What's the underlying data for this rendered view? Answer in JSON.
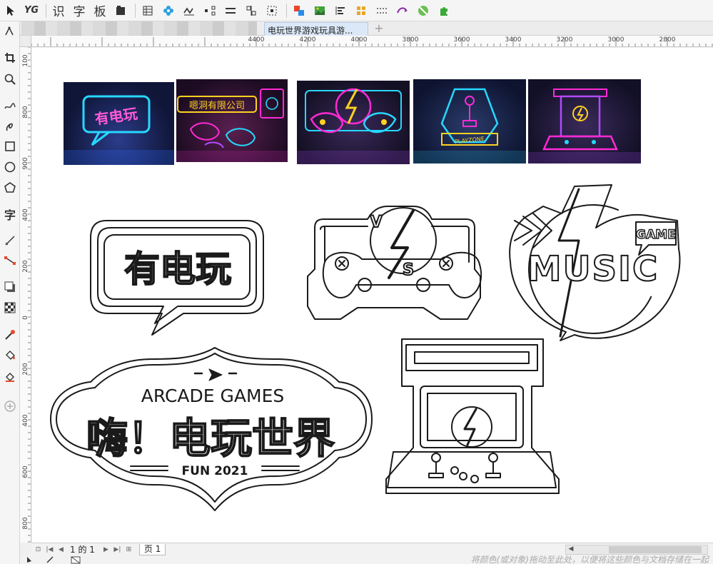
{
  "toolbar": {
    "text_tools": [
      "识",
      "字",
      "板"
    ],
    "icons": [
      "select-arrow-icon",
      "yg-logo-icon",
      "book-icon",
      "grid-icon",
      "flower-icon",
      "pen-path-icon",
      "node-icon",
      "align-icon",
      "distribute-icon",
      "dashed-select-icon",
      "color-swap-icon",
      "image-icon",
      "text-align-icon",
      "palette-icon",
      "dots-icon",
      "arrows-icon",
      "ball-icon",
      "puzzle-icon"
    ],
    "yg_label": "YG"
  },
  "tabs": {
    "active": "电玩世界游戏玩具游...",
    "add": "+"
  },
  "ruler": {
    "h_labels": [
      "4400",
      "4200",
      "4000",
      "3800",
      "3600",
      "3400",
      "3200",
      "3000",
      "2800"
    ],
    "v_labels": [
      "100",
      "800",
      "900",
      "400",
      "200",
      "0",
      "200",
      "400",
      "600",
      "800"
    ]
  },
  "toolbox": {
    "text_tool_label": "字"
  },
  "artwork": {
    "sign1": "有电玩",
    "sign2_v": "V",
    "sign2_s": "S",
    "sign3_game": "GAME",
    "sign3_music": "MUSIC",
    "sign4_arcade": "ARCADE GAMES",
    "sign4_main": "嗨！电玩世界",
    "sign4_fun": "FUN 2021",
    "neon1": "有电玩",
    "neon2": "嗯洞有限公司",
    "neon4": "PLAYZONE"
  },
  "pagebar": {
    "page_info": "1 的 1",
    "page_tab": "页 1"
  },
  "status": {
    "hint": "将颜色(或对象)拖动至此处，以便将这些颜色与文档存储在一起"
  },
  "colors": {
    "neon_cyan": "#27d8ff",
    "neon_pink": "#ff2ad4",
    "neon_purple": "#b04bff",
    "neon_yellow": "#ffd21f",
    "neon_blue": "#2d6dff"
  }
}
